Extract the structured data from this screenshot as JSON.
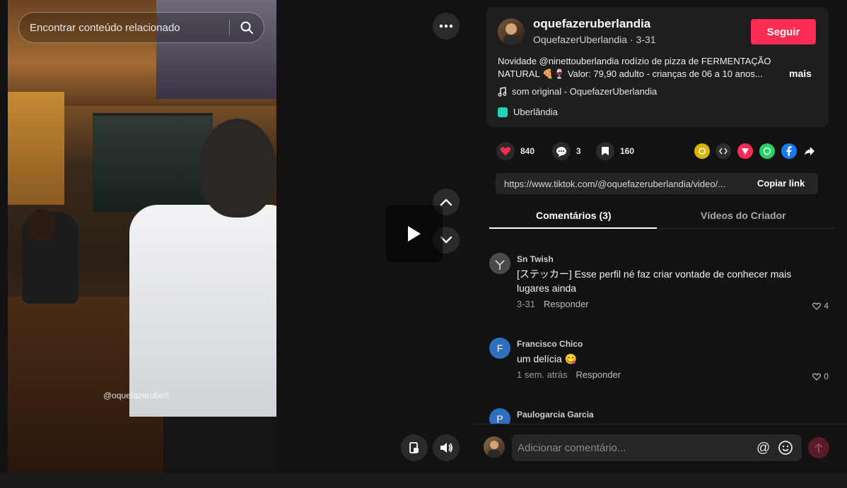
{
  "search": {
    "placeholder": "Encontrar conteúdo relacionado"
  },
  "video": {
    "watermark": "@oquefazeruberl"
  },
  "author": {
    "username": "oquefazeruberlandia",
    "display_name": "OquefazerUberlandia",
    "date": "3-31",
    "subline_sep": " · ",
    "follow_label": "Seguir"
  },
  "description": {
    "text": "Novidade @ninettouberlandia rodízio de pizza de FERMENTAÇÃO NATURAL 🍕🍷 Valor: 79,90 adulto - crianças de 06 a 10 anos...",
    "more_label": "mais"
  },
  "music": {
    "label": "som original - OquefazerUberlandia"
  },
  "location": {
    "label": "Uberlândia"
  },
  "stats": {
    "likes": "840",
    "comments": "3",
    "saves": "160"
  },
  "share": {
    "link": "https://www.tiktok.com/@oquefazeruberlandia/video/...",
    "copy_label": "Copiar link"
  },
  "tabs": {
    "comments": "Comentários (3)",
    "videos": "Vídeos do Criador"
  },
  "comments": [
    {
      "name": "Sn Twish",
      "text": "[ステッカー] Esse perfil né faz criar vontade de conhecer mais lugares ainda",
      "time": "3-31",
      "reply": "Responder",
      "likes": "4"
    },
    {
      "name": "Francisco Chico",
      "avatar_letter": "F",
      "text": "um delícia 😋",
      "time": "1 sem. atrás",
      "reply": "Responder",
      "likes": "0"
    },
    {
      "name": "Paulogarcia Garcia",
      "avatar_letter": "P"
    }
  ],
  "composer": {
    "placeholder": "Adicionar comentário...",
    "at_symbol": "@"
  },
  "colors": {
    "accent": "#fe2c55",
    "panel": "#121212",
    "card": "#1e1e1e",
    "link_box": "#252525"
  }
}
